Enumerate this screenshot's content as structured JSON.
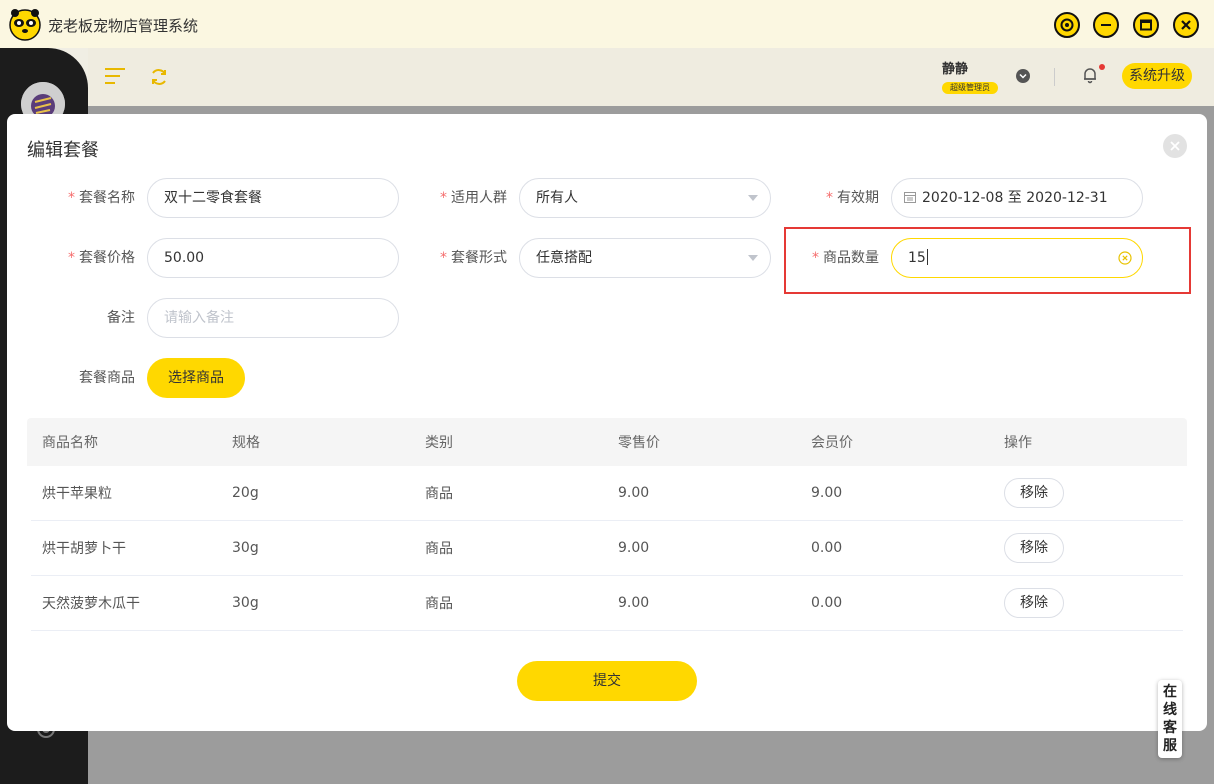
{
  "app": {
    "title": "宠老板宠物店管理系统"
  },
  "header": {
    "user_name": "静静",
    "user_role": "超级管理员",
    "upgrade_label": "系统升级"
  },
  "modal": {
    "title": "编辑套餐",
    "fields": {
      "name_label": "套餐名称",
      "name_value": "双十二零食套餐",
      "audience_label": "适用人群",
      "audience_value": "所有人",
      "validity_label": "有效期",
      "validity_value": "2020-12-08 至 2020-12-31",
      "price_label": "套餐价格",
      "price_value": "50.00",
      "form_label": "套餐形式",
      "form_value": "任意搭配",
      "quantity_label": "商品数量",
      "quantity_value": "15",
      "note_label": "备注",
      "note_placeholder": "请输入备注",
      "goods_label": "套餐商品",
      "select_goods_label": "选择商品"
    },
    "table": {
      "headers": [
        "商品名称",
        "规格",
        "类别",
        "零售价",
        "会员价",
        "操作"
      ],
      "rows": [
        {
          "name": "烘干苹果粒",
          "spec": "20g",
          "category": "商品",
          "retail": "9.00",
          "member": "9.00",
          "action": "移除"
        },
        {
          "name": "烘干胡萝卜干",
          "spec": "30g",
          "category": "商品",
          "retail": "9.00",
          "member": "0.00",
          "action": "移除"
        },
        {
          "name": "天然菠萝木瓜干",
          "spec": "30g",
          "category": "商品",
          "retail": "9.00",
          "member": "0.00",
          "action": "移除"
        }
      ]
    },
    "submit_label": "提交"
  },
  "service": {
    "label": "在线客服"
  },
  "colors": {
    "accent": "#ffd800",
    "highlight": "#e53935",
    "sidebar": "#1c1c1c"
  }
}
